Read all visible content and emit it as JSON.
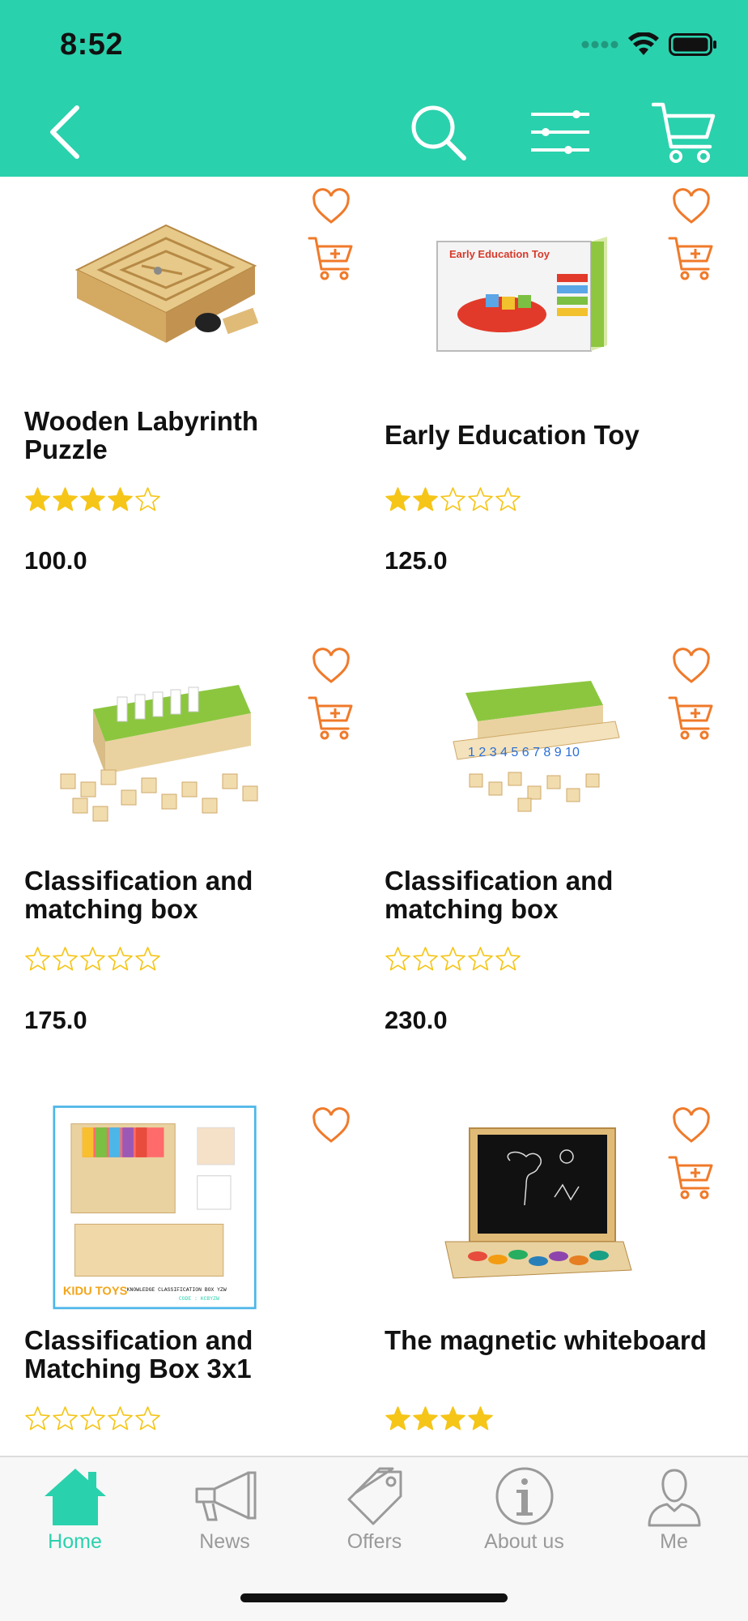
{
  "status_bar": {
    "time": "8:52"
  },
  "colors": {
    "accent": "#2ad1ad",
    "icon_orange": "#f07a2a",
    "star_gold": "#f5c518",
    "text": "#111111",
    "tab_inactive": "#9a9a9a"
  },
  "header": {
    "back_icon": "chevron-left-icon",
    "search_icon": "search-icon",
    "filter_icon": "sliders-icon",
    "cart_icon": "cart-icon"
  },
  "products": [
    {
      "name": "Wooden Labyrinth Puzzle",
      "rating": 4,
      "max_rating": 5,
      "price": "100.0",
      "image": "wooden-labyrinth-image"
    },
    {
      "name": "Early Education Toy",
      "rating": 2,
      "max_rating": 5,
      "price": "125.0",
      "image": "early-education-toy-image"
    },
    {
      "name": "Classification and matching box",
      "rating": 0,
      "max_rating": 5,
      "price": "175.0",
      "image": "classification-box-image"
    },
    {
      "name": "Classification and matching box",
      "rating": 0,
      "max_rating": 5,
      "price": "230.0",
      "image": "classification-box-numbers-image"
    },
    {
      "name": "Classification and Matching Box 3x1",
      "rating": 0,
      "max_rating": 5,
      "price": "",
      "image": "classification-box-3x1-image",
      "image_text": {
        "brand": "KIDU TOYS",
        "caption": "KNOWLEDGE CLASSIFICATION BOX YZW",
        "code": "CODE : KCBYZW"
      }
    },
    {
      "name": "The magnetic whiteboard",
      "rating": 4,
      "max_rating": 4,
      "price": "",
      "image": "magnetic-whiteboard-image"
    }
  ],
  "tabs": [
    {
      "label": "Home",
      "icon": "home-icon",
      "active": true
    },
    {
      "label": "News",
      "icon": "megaphone-icon",
      "active": false
    },
    {
      "label": "Offers",
      "icon": "tag-icon",
      "active": false
    },
    {
      "label": "About us",
      "icon": "info-icon",
      "active": false
    },
    {
      "label": "Me",
      "icon": "person-icon",
      "active": false
    }
  ]
}
